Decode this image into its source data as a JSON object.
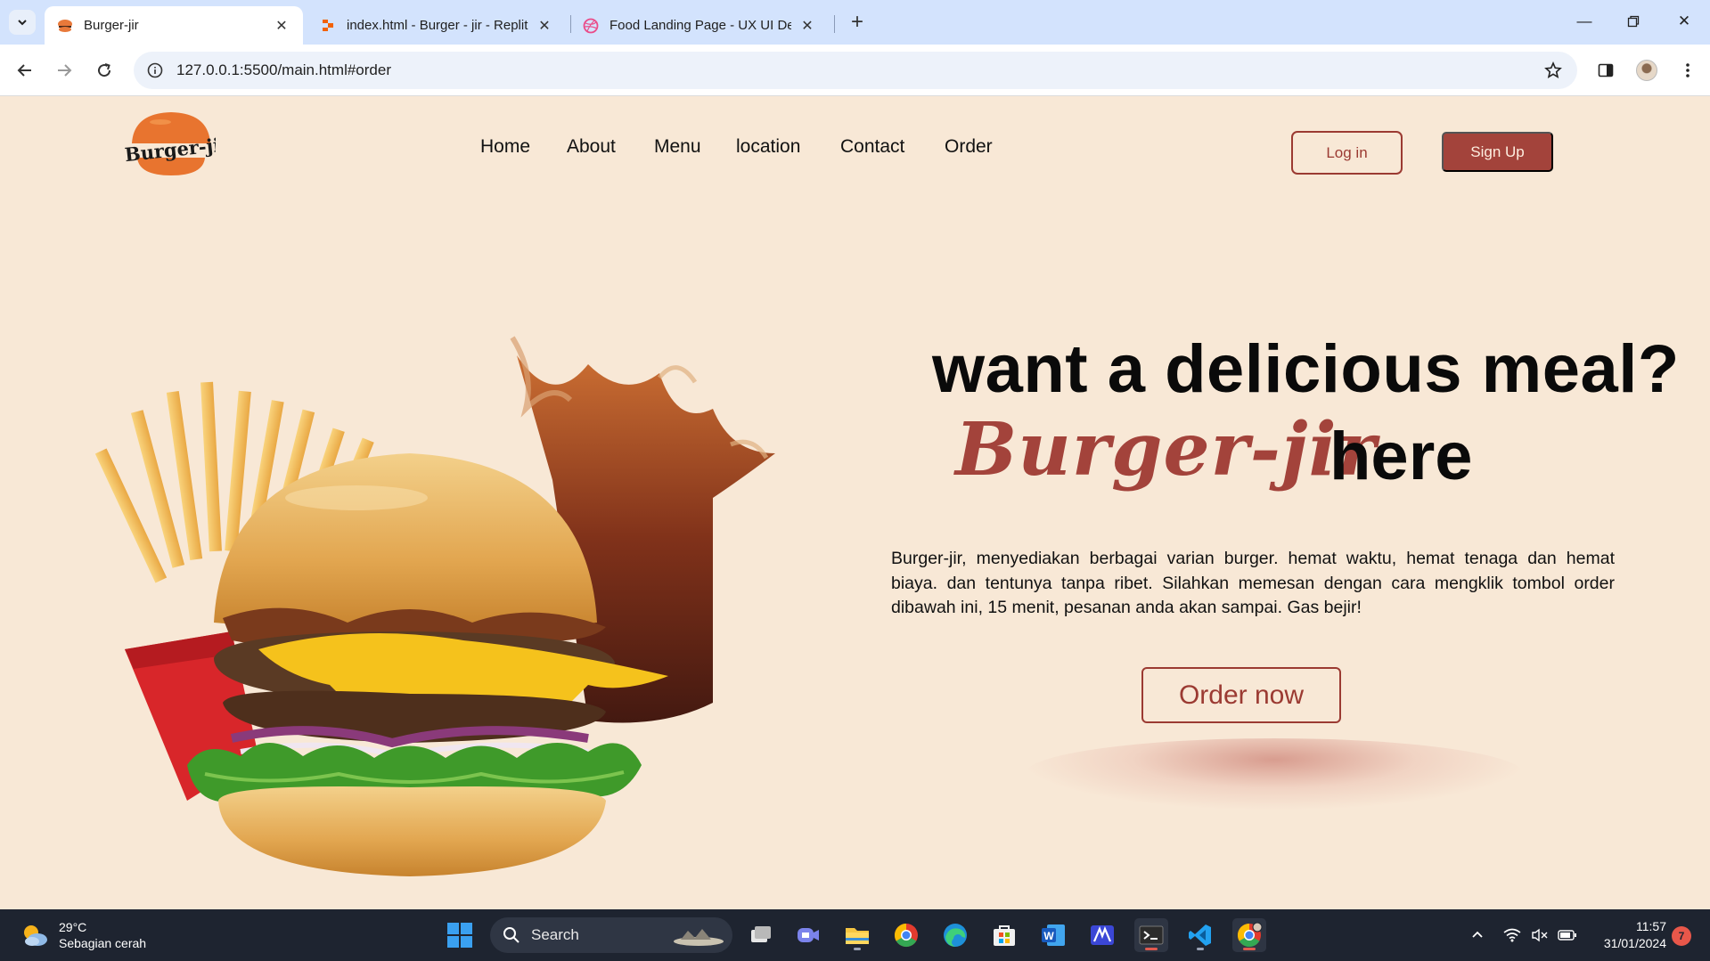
{
  "browser": {
    "tabs": [
      {
        "title": "Burger-jir",
        "active": true,
        "icon": "burger-favicon"
      },
      {
        "title": "index.html - Burger - jir - Replit",
        "active": false,
        "icon": "replit-favicon"
      },
      {
        "title": "Food Landing Page - UX UI Design",
        "active": false,
        "icon": "dribbble-favicon"
      }
    ],
    "url": "127.0.0.1:5500/main.html#order"
  },
  "site": {
    "logo_text": "Burger-jir",
    "nav": [
      "Home",
      "About",
      "Menu",
      "location",
      "Contact",
      "Order"
    ],
    "login_label": "Log in",
    "signup_label": "Sign Up",
    "headline": "want a delicious meal?",
    "brand": "Burger-jir",
    "here": "here",
    "description": "Burger-jir, menyediakan berbagai varian burger. hemat waktu, hemat tenaga dan hemat biaya. dan tentunya tanpa ribet. Silahkan memesan dengan cara mengklik tombol order dibawah ini, 15 menit, pesanan anda akan sampai. Gas bejir!",
    "order_label": "Order now",
    "colors": {
      "accent": "#a3433b",
      "background": "#f8e8d6"
    }
  },
  "taskbar": {
    "temperature": "29°C",
    "weather": "Sebagian cerah",
    "search_label": "Search",
    "time": "11:57",
    "date": "31/01/2024",
    "notifications": "7"
  }
}
